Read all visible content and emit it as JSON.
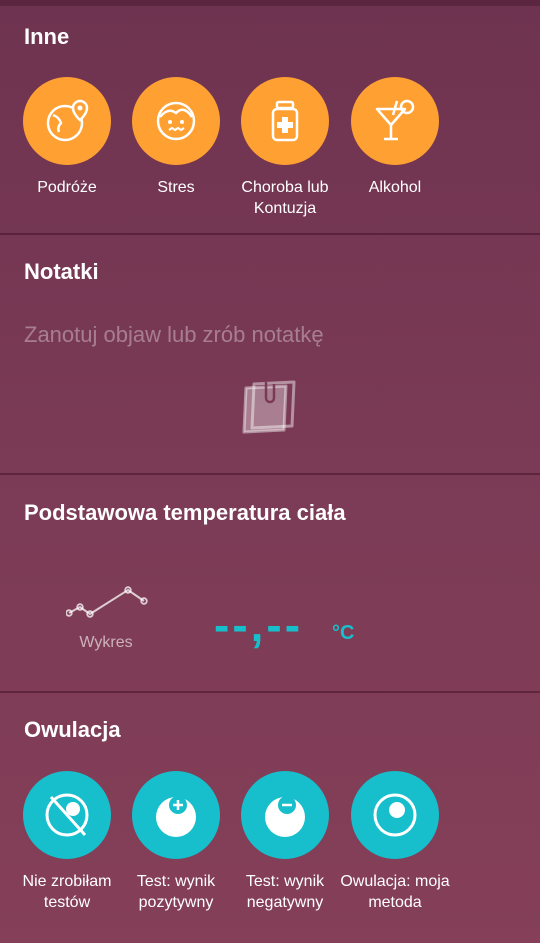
{
  "inne": {
    "title": "Inne",
    "items": [
      {
        "label": "Podróże",
        "icon": "travel-globe-icon"
      },
      {
        "label": "Stres",
        "icon": "stressed-face-icon"
      },
      {
        "label": "Choroba lub Kontuzja",
        "icon": "medicine-bottle-icon"
      },
      {
        "label": "Alkohol",
        "icon": "cocktail-glass-icon"
      }
    ]
  },
  "notes": {
    "title": "Notatki",
    "placeholder": "Zanotuj objaw lub zrób notatkę",
    "icon": "note-paper-icon"
  },
  "temperature": {
    "title": "Podstawowa temperatura ciała",
    "chart_label": "Wykres",
    "value": "--,--",
    "unit": "°C",
    "chart_icon": "line-chart-icon"
  },
  "ovulation": {
    "title": "Owulacja",
    "items": [
      {
        "label": "Nie zrobiłam testów",
        "icon": "no-test-icon"
      },
      {
        "label": "Test: wynik pozytywny",
        "icon": "test-positive-icon"
      },
      {
        "label": "Test: wynik negatywny",
        "icon": "test-negative-icon"
      },
      {
        "label": "Owulacja: moja metoda",
        "icon": "ovulation-method-icon"
      }
    ]
  },
  "colors": {
    "orange": "#ffa033",
    "teal": "#16bfcb",
    "background": "#7a3a55"
  }
}
